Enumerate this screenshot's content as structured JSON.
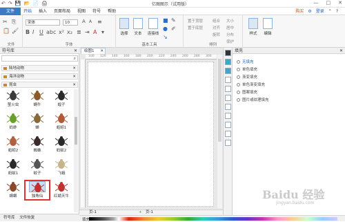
{
  "app": {
    "title": "亿图图示（试用版）",
    "quick_access": [
      "↶",
      "↷",
      "💾",
      "📂",
      "📄",
      "🖨"
    ],
    "window_controls": [
      "—",
      "□",
      "✕"
    ]
  },
  "menubar": {
    "file": "文件",
    "items": [
      "开始",
      "插入",
      "页面布局",
      "视图",
      "符号",
      "帮助"
    ],
    "active": "开始",
    "right": [
      "购买",
      "⚙",
      "登录",
      "⌃",
      "?"
    ]
  },
  "ribbon": {
    "groups": [
      "文件",
      "字体",
      "基本工具",
      "排列",
      ""
    ],
    "font_name": "宋体",
    "font_size": "10",
    "basic_tools": {
      "select": "选择",
      "text": "文本",
      "connector": "连接线"
    },
    "arrange": [
      "置于顶层",
      "置于底层",
      "组合",
      "对齐",
      "旋转",
      "居中",
      "分布",
      "保护",
      "大小"
    ],
    "style_label": "样式",
    "edit_label": "编辑"
  },
  "left_panel": {
    "title": "符号库",
    "categories": [
      "陆地动物",
      "海洋动物",
      "昆虫"
    ],
    "symbols": [
      {
        "name": "萤火虫",
        "color": "#3a3a3a"
      },
      {
        "name": "蜗牛",
        "color": "#8a5a2a"
      },
      {
        "name": "蝗子",
        "color": "#2a2a2a"
      },
      {
        "name": "蚂蚱",
        "color": "#6a9e2a"
      },
      {
        "name": "蝉",
        "color": "#8a6a3a"
      },
      {
        "name": "蚯蚓1",
        "color": "#b05a3a"
      },
      {
        "name": "蚯蚓2",
        "color": "#b06040"
      },
      {
        "name": "蜘蛛",
        "color": "#3a2a2a"
      },
      {
        "name": "蚂蚁2",
        "color": "#2a2a2a"
      },
      {
        "name": "蚂蚁1",
        "color": "#2a2a2a"
      },
      {
        "name": "蚊子",
        "color": "#555555"
      },
      {
        "name": "飞蛾",
        "color": "#c8b48a"
      },
      {
        "name": "蟑螂",
        "color": "#8a4a2a"
      },
      {
        "name": "独角仙",
        "color": "#c03030"
      },
      {
        "name": "红蜻天牛",
        "color": "#c03030"
      }
    ],
    "selected": "独角仙",
    "bottom_tabs": [
      "符号库",
      "文件恢复"
    ]
  },
  "document": {
    "tab": "绘图1",
    "ruler_marks": [
      "100",
      "120",
      "140",
      "160",
      "180",
      "200",
      "220",
      "240",
      "260",
      "280",
      "300"
    ],
    "page_label_left": "页-1",
    "page_label_right": "页-1",
    "add_page": "+"
  },
  "right_panel": {
    "title": "填充",
    "options": [
      "无填充",
      "单色填充",
      "渐变填充",
      "单色渐变填充",
      "图案填充",
      "图片或纹理填充"
    ],
    "selected": "无填充"
  },
  "colorbar_label": "填充",
  "watermark": "Baidu 经验",
  "watermark_sub": "jingyan.baidu.com"
}
